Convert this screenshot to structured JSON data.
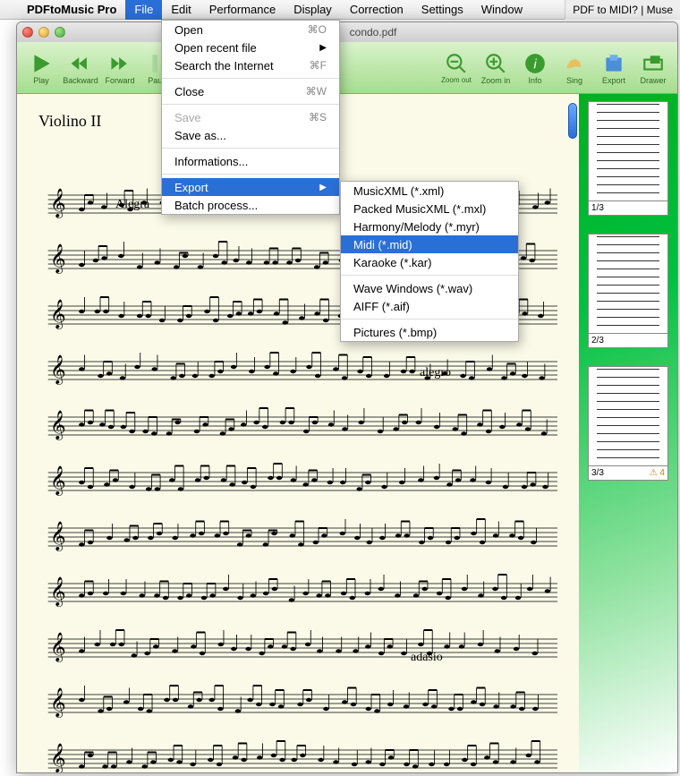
{
  "menubar": {
    "app_name": "PDFtoMusic Pro",
    "items": [
      "File",
      "Edit",
      "Performance",
      "Display",
      "Correction",
      "Settings",
      "Window"
    ],
    "right_tab": "PDF to MIDI? | Muse"
  },
  "window": {
    "title": "condo.pdf"
  },
  "toolbar": {
    "buttons": [
      {
        "label": "Play",
        "icon": "play"
      },
      {
        "label": "Backward",
        "icon": "backward"
      },
      {
        "label": "Forward",
        "icon": "forward"
      },
      {
        "label": "Pause",
        "icon": "pause"
      },
      {
        "label": "Zoom out",
        "icon": "zoomout"
      },
      {
        "label": "Zoom in",
        "icon": "zoomin"
      },
      {
        "label": "Info",
        "icon": "info"
      },
      {
        "label": "Sing",
        "icon": "sing"
      },
      {
        "label": "Export",
        "icon": "export"
      },
      {
        "label": "Drawer",
        "icon": "drawer"
      }
    ]
  },
  "score": {
    "part_title": "Violino II",
    "tempo1": "Alegra",
    "tempo2": "alegro",
    "tempo3": "adasio"
  },
  "thumbnails": [
    {
      "label": "1/3",
      "warn": ""
    },
    {
      "label": "2/3",
      "warn": ""
    },
    {
      "label": "3/3",
      "warn": "⚠ 4"
    }
  ],
  "file_menu": {
    "items": [
      {
        "label": "Open",
        "shortcut": "⌘O"
      },
      {
        "label": "Open recent file",
        "submenu": true
      },
      {
        "label": "Search the Internet",
        "shortcut": "⌘F"
      },
      {
        "sep": true
      },
      {
        "label": "Close",
        "shortcut": "⌘W"
      },
      {
        "sep": true
      },
      {
        "label": "Save",
        "shortcut": "⌘S",
        "disabled": true
      },
      {
        "label": "Save as..."
      },
      {
        "sep": true
      },
      {
        "label": "Informations..."
      },
      {
        "sep": true
      },
      {
        "label": "Export",
        "submenu": true,
        "highlight": true
      },
      {
        "label": "Batch process..."
      }
    ]
  },
  "export_menu": {
    "items": [
      {
        "label": "MusicXML (*.xml)"
      },
      {
        "label": "Packed MusicXML (*.mxl)"
      },
      {
        "label": "Harmony/Melody (*.myr)"
      },
      {
        "label": "Midi (*.mid)",
        "highlight": true
      },
      {
        "label": "Karaoke (*.kar)"
      },
      {
        "sep": true
      },
      {
        "label": "Wave Windows (*.wav)"
      },
      {
        "label": "AIFF (*.aif)"
      },
      {
        "sep": true
      },
      {
        "label": "Pictures  (*.bmp)"
      }
    ]
  }
}
